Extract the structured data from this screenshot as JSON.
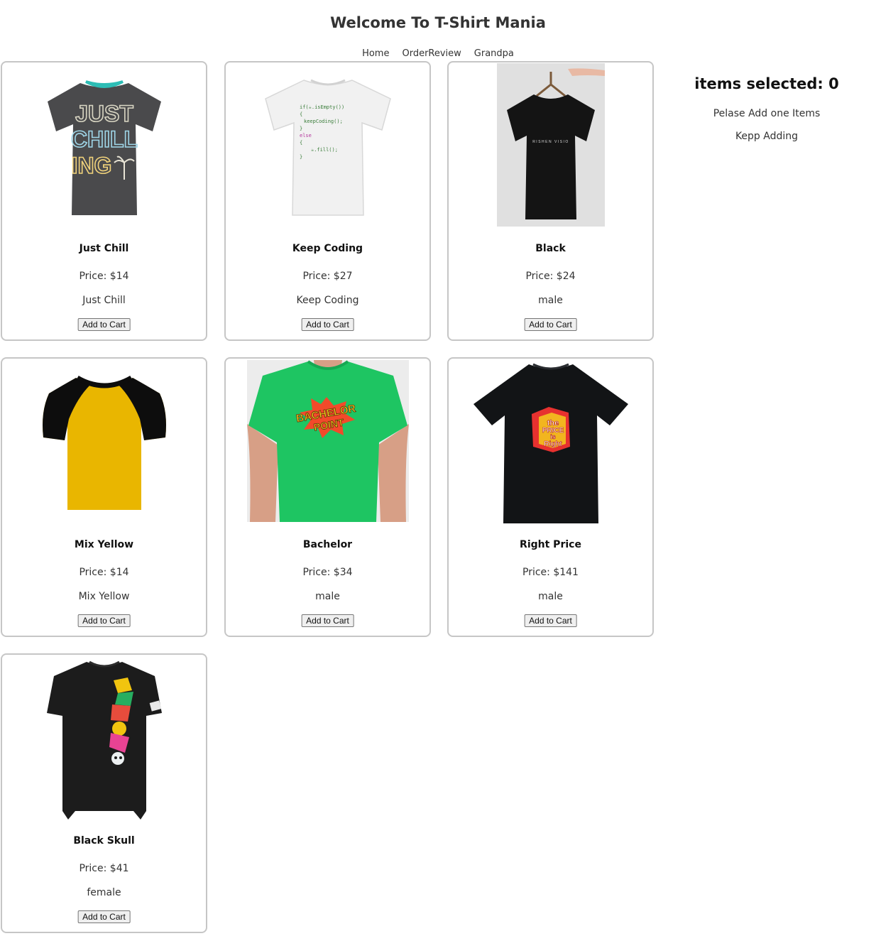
{
  "header": {
    "title": "Welcome To T-Shirt Mania"
  },
  "nav": {
    "items": [
      "Home",
      "OrderReview",
      "Grandpa"
    ]
  },
  "products": [
    {
      "name": "Just Chill",
      "price": "Price: $14",
      "description": "Just Chill",
      "button": "Add to Cart",
      "art_lines": [
        "JUST",
        "CHILL",
        "ING"
      ]
    },
    {
      "name": "Keep Coding",
      "price": "Price: $27",
      "description": "Keep Coding",
      "button": "Add to Cart",
      "art_lines": [
        "if(☕.isEmpty())",
        "{",
        "keepCoding();",
        "}",
        "else",
        "{",
        "☕.fill();",
        "}"
      ]
    },
    {
      "name": "Black",
      "price": "Price: $24",
      "description": "male",
      "button": "Add to Cart",
      "art_lines": [
        "RISHEN VISIO"
      ]
    },
    {
      "name": "Mix Yellow",
      "price": "Price: $14",
      "description": "Mix Yellow",
      "button": "Add to Cart"
    },
    {
      "name": "Bachelor",
      "price": "Price: $34",
      "description": "male",
      "button": "Add to Cart",
      "art_lines": [
        "BACHELOR",
        "POINT"
      ]
    },
    {
      "name": "Right Price",
      "price": "Price: $141",
      "description": "male",
      "button": "Add to Cart",
      "art_lines": [
        "the",
        "PRICE",
        "is",
        "Right"
      ]
    },
    {
      "name": "Black Skull",
      "price": "Price: $41",
      "description": "female",
      "button": "Add to Cart"
    }
  ],
  "cart": {
    "heading": "items selected: 0",
    "message1": "Pelase Add one Items",
    "message2": "Kepp Adding"
  },
  "colors": {
    "card_border": "#c6c6c6",
    "shirt_gray": "#4a4a4c",
    "shirt_white": "#f1f1f1",
    "shirt_black": "#161616",
    "shirt_yellow": "#e9b600",
    "shirt_green": "#1ec562"
  },
  "icons": [
    "tshirt-image"
  ]
}
